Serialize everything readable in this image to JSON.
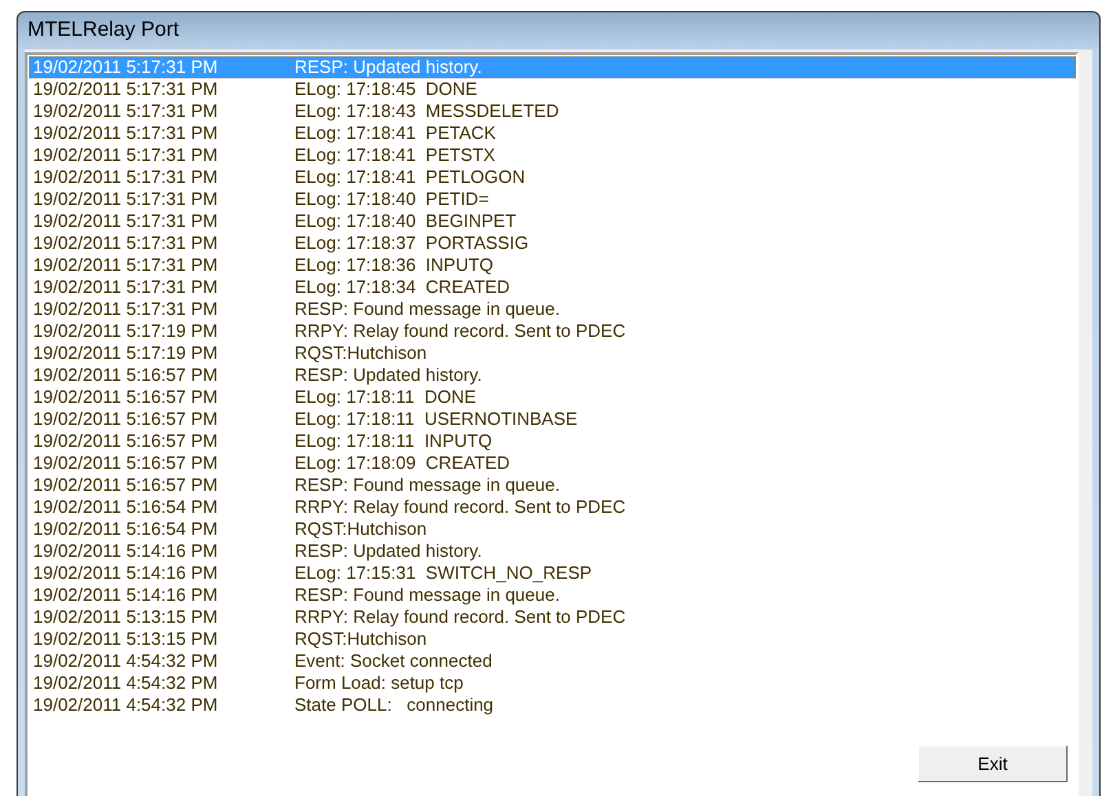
{
  "window": {
    "title": "MTELRelay Port"
  },
  "log": [
    {
      "time": "19/02/2011 5:17:31 PM",
      "message": "RESP: Updated history.",
      "selected": true
    },
    {
      "time": "19/02/2011 5:17:31 PM",
      "message": "ELog: 17:18:45  DONE",
      "selected": false
    },
    {
      "time": "19/02/2011 5:17:31 PM",
      "message": "ELog: 17:18:43  MESSDELETED",
      "selected": false
    },
    {
      "time": "19/02/2011 5:17:31 PM",
      "message": "ELog: 17:18:41  PETACK",
      "selected": false
    },
    {
      "time": "19/02/2011 5:17:31 PM",
      "message": "ELog: 17:18:41  PETSTX",
      "selected": false
    },
    {
      "time": "19/02/2011 5:17:31 PM",
      "message": "ELog: 17:18:41  PETLOGON",
      "selected": false
    },
    {
      "time": "19/02/2011 5:17:31 PM",
      "message": "ELog: 17:18:40  PETID=",
      "selected": false
    },
    {
      "time": "19/02/2011 5:17:31 PM",
      "message": "ELog: 17:18:40  BEGINPET",
      "selected": false
    },
    {
      "time": "19/02/2011 5:17:31 PM",
      "message": "ELog: 17:18:37  PORTASSIG",
      "selected": false
    },
    {
      "time": "19/02/2011 5:17:31 PM",
      "message": "ELog: 17:18:36  INPUTQ",
      "selected": false
    },
    {
      "time": "19/02/2011 5:17:31 PM",
      "message": "ELog: 17:18:34  CREATED",
      "selected": false
    },
    {
      "time": "19/02/2011 5:17:31 PM",
      "message": "RESP: Found message in queue.",
      "selected": false
    },
    {
      "time": "19/02/2011 5:17:19 PM",
      "message": "RRPY: Relay found record. Sent to PDEC",
      "selected": false
    },
    {
      "time": "19/02/2011 5:17:19 PM",
      "message": "RQST:Hutchison",
      "selected": false
    },
    {
      "time": "19/02/2011 5:16:57 PM",
      "message": "RESP: Updated history.",
      "selected": false
    },
    {
      "time": "19/02/2011 5:16:57 PM",
      "message": "ELog: 17:18:11  DONE",
      "selected": false
    },
    {
      "time": "19/02/2011 5:16:57 PM",
      "message": "ELog: 17:18:11  USERNOTINBASE",
      "selected": false
    },
    {
      "time": "19/02/2011 5:16:57 PM",
      "message": "ELog: 17:18:11  INPUTQ",
      "selected": false
    },
    {
      "time": "19/02/2011 5:16:57 PM",
      "message": "ELog: 17:18:09  CREATED",
      "selected": false
    },
    {
      "time": "19/02/2011 5:16:57 PM",
      "message": "RESP: Found message in queue.",
      "selected": false
    },
    {
      "time": "19/02/2011 5:16:54 PM",
      "message": "RRPY: Relay found record. Sent to PDEC",
      "selected": false
    },
    {
      "time": "19/02/2011 5:16:54 PM",
      "message": "RQST:Hutchison",
      "selected": false
    },
    {
      "time": "19/02/2011 5:14:16 PM",
      "message": "RESP: Updated history.",
      "selected": false
    },
    {
      "time": "19/02/2011 5:14:16 PM",
      "message": "ELog: 17:15:31  SWITCH_NO_RESP",
      "selected": false
    },
    {
      "time": "19/02/2011 5:14:16 PM",
      "message": "RESP: Found message in queue.",
      "selected": false
    },
    {
      "time": "19/02/2011 5:13:15 PM",
      "message": "RRPY: Relay found record. Sent to PDEC",
      "selected": false
    },
    {
      "time": "19/02/2011 5:13:15 PM",
      "message": "RQST:Hutchison",
      "selected": false
    },
    {
      "time": "19/02/2011 4:54:32 PM",
      "message": "Event: Socket connected",
      "selected": false
    },
    {
      "time": "19/02/2011 4:54:32 PM",
      "message": "Form Load: setup tcp",
      "selected": false
    },
    {
      "time": "19/02/2011 4:54:32 PM",
      "message": "State POLL:   connecting",
      "selected": false
    }
  ],
  "buttons": [
    {
      "label": "Exit"
    }
  ]
}
